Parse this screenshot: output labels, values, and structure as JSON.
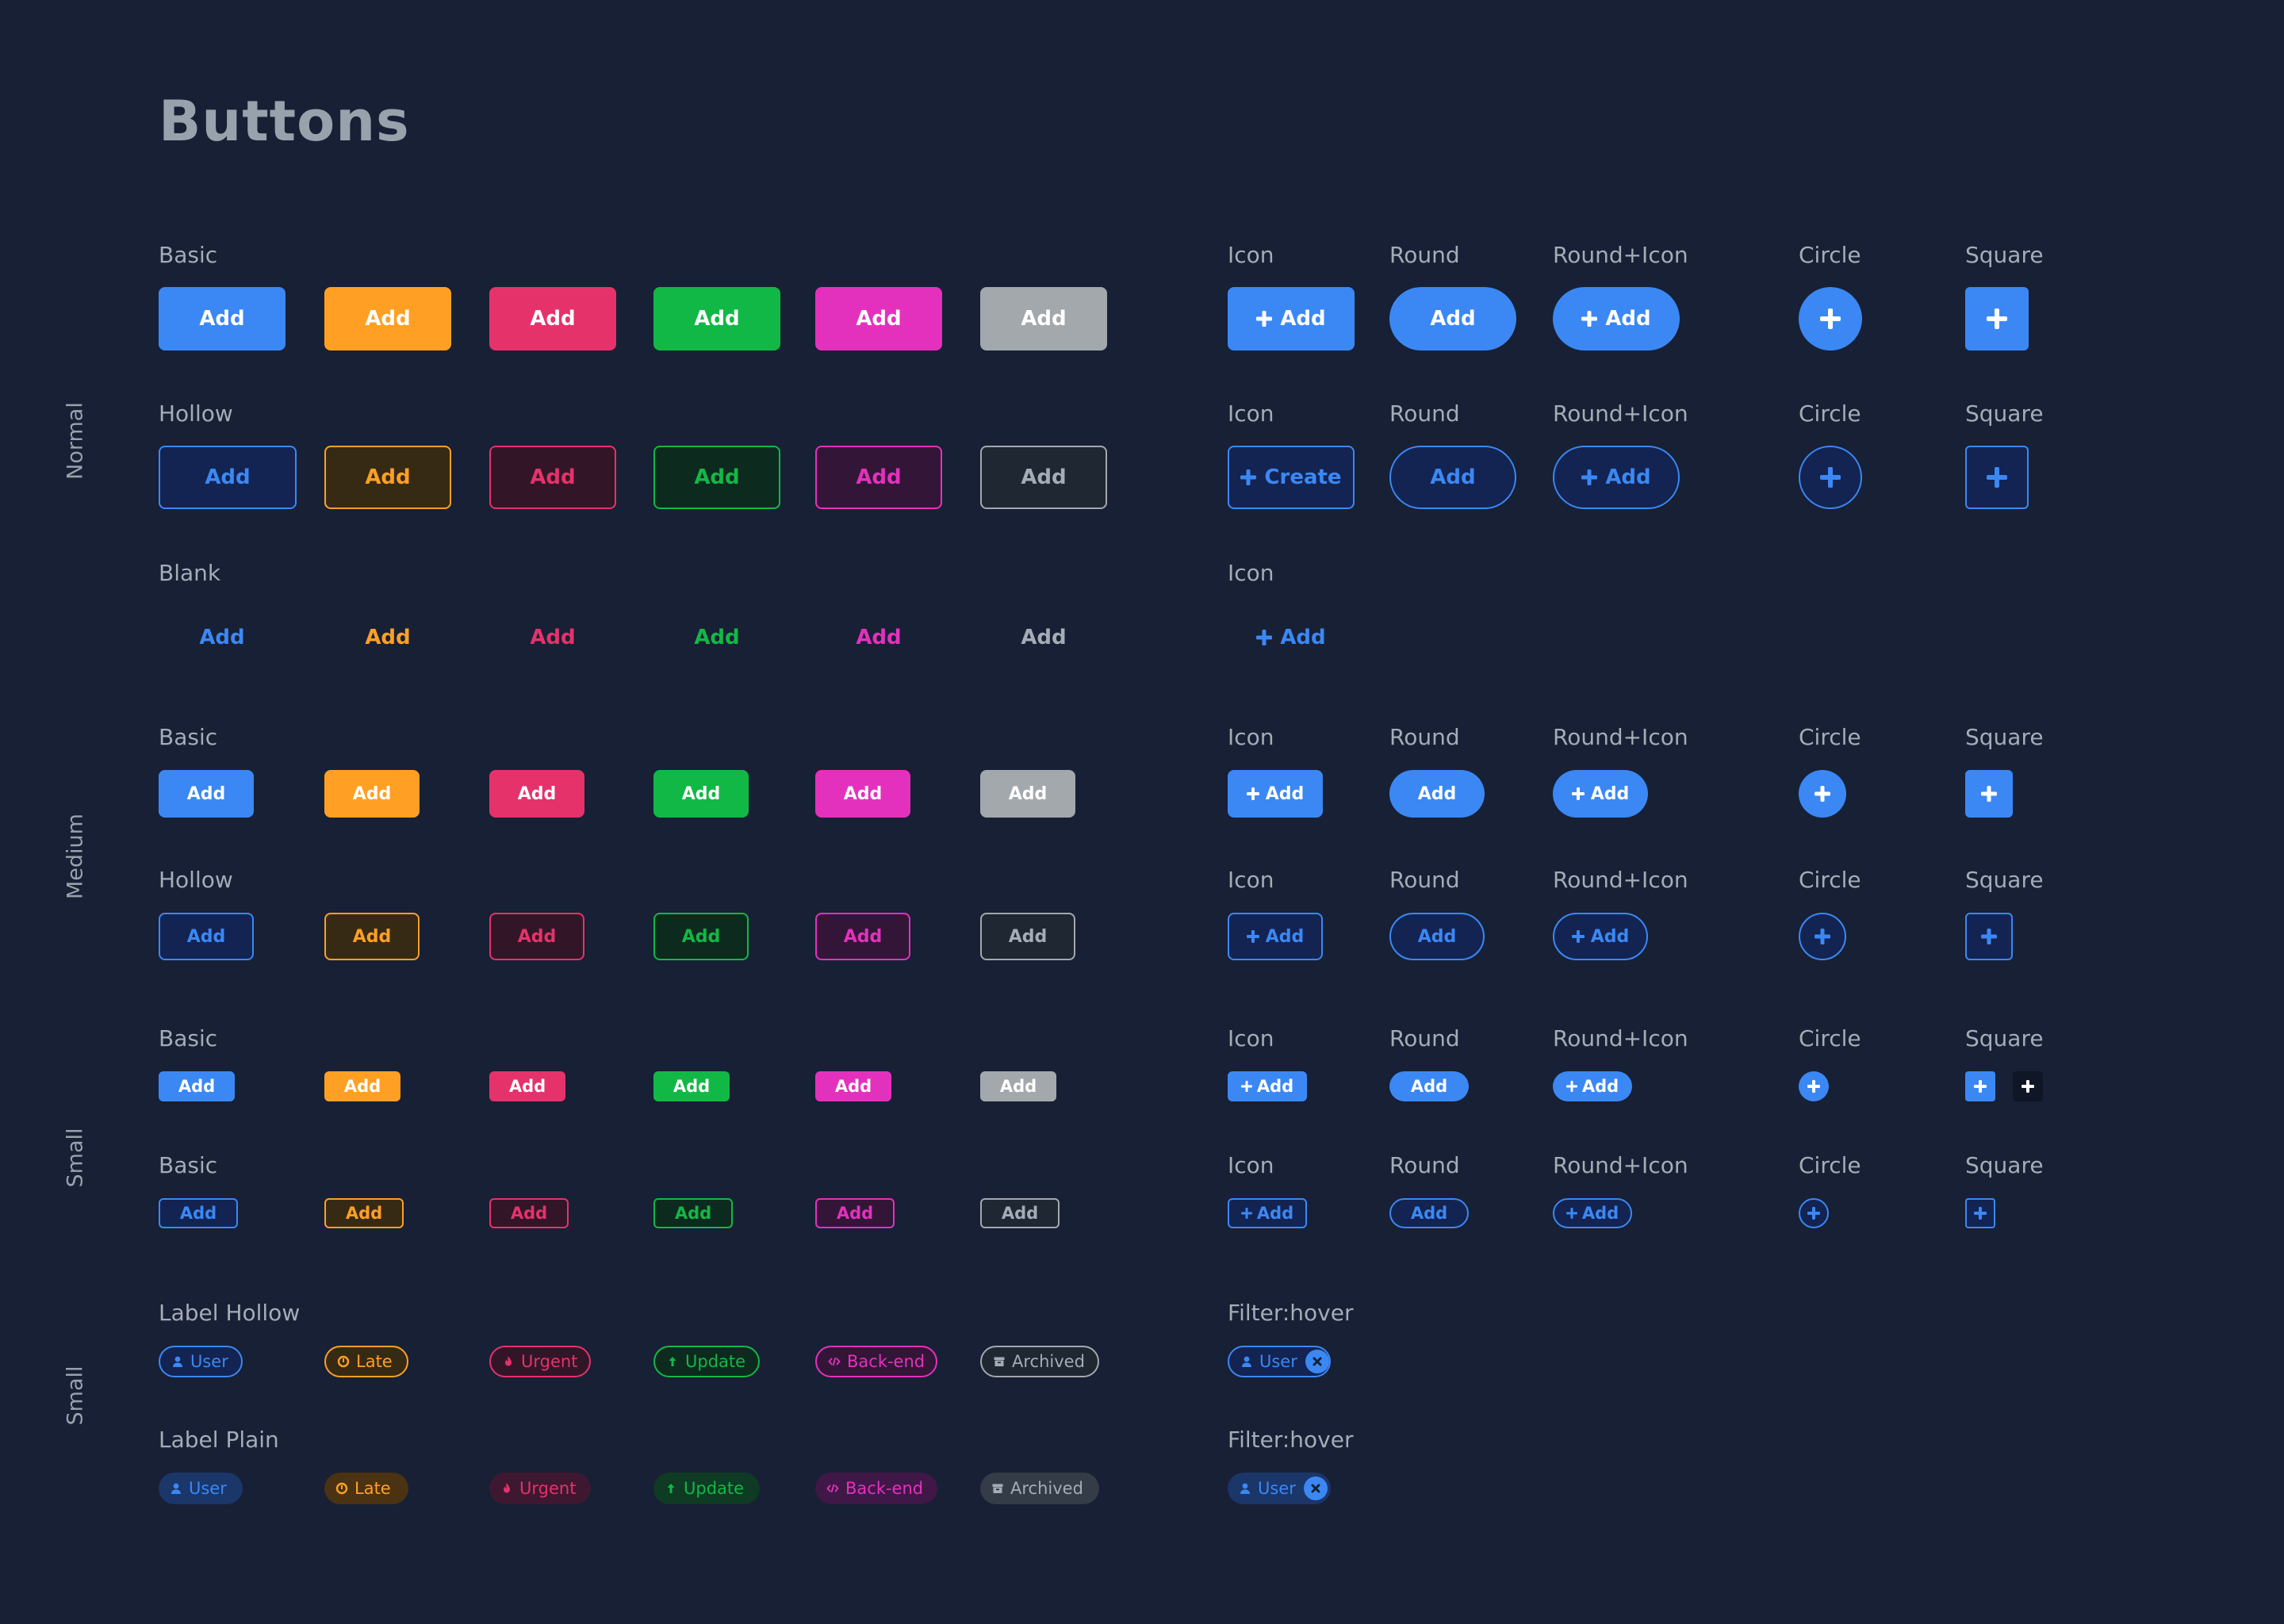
{
  "page_title": "Buttons",
  "row_groups": [
    {
      "label": "Normal"
    },
    {
      "label": "Medium"
    },
    {
      "label": "Small"
    },
    {
      "label": "Small"
    }
  ],
  "sections": {
    "normal_basic": {
      "label": "Basic",
      "variants": [
        "Add",
        "Add",
        "Add",
        "Add",
        "Add",
        "Add"
      ]
    },
    "normal_hollow": {
      "label": "Hollow",
      "variants": [
        "Add",
        "Add",
        "Add",
        "Add",
        "Add",
        "Add"
      ]
    },
    "normal_blank": {
      "label": "Blank",
      "variants": [
        "Add",
        "Add",
        "Add",
        "Add",
        "Add",
        "Add"
      ]
    },
    "medium_basic": {
      "label": "Basic",
      "variants": [
        "Add",
        "Add",
        "Add",
        "Add",
        "Add",
        "Add"
      ]
    },
    "medium_hollow": {
      "label": "Hollow",
      "variants": [
        "Add",
        "Add",
        "Add",
        "Add",
        "Add",
        "Add"
      ]
    },
    "small_basic": {
      "label": "Basic",
      "variants": [
        "Add",
        "Add",
        "Add",
        "Add",
        "Add",
        "Add"
      ]
    },
    "small_hollow": {
      "label": "Basic",
      "variants": [
        "Add",
        "Add",
        "Add",
        "Add",
        "Add",
        "Add"
      ]
    },
    "label_hollow": {
      "label": "Label Hollow",
      "tags": [
        "User",
        "Late",
        "Urgent",
        "Update",
        "Back-end",
        "Archived"
      ]
    },
    "label_plain": {
      "label": "Label Plain",
      "tags": [
        "User",
        "Late",
        "Urgent",
        "Update",
        "Back-end",
        "Archived"
      ]
    }
  },
  "shape_headers": {
    "icon": "Icon",
    "round": "Round",
    "round_icon": "Round+Icon",
    "circle": "Circle",
    "square": "Square",
    "filter_hover": "Filter:hover"
  },
  "shape_buttons": {
    "add": "Add",
    "create": "Create"
  },
  "colors": {
    "background": "#172035",
    "blue": "#3b88f4",
    "orange": "#ffa024",
    "red": "#e5326b",
    "green": "#12b846",
    "magenta": "#e431bd",
    "gray": "#a3a8ad"
  },
  "icons": {
    "plus": "plus-icon",
    "user": "user-icon",
    "late": "clock-icon",
    "urgent": "fire-icon",
    "update": "arrow-up-icon",
    "back_end": "code-icon",
    "archived": "archive-icon",
    "remove": "close-circle-icon"
  }
}
